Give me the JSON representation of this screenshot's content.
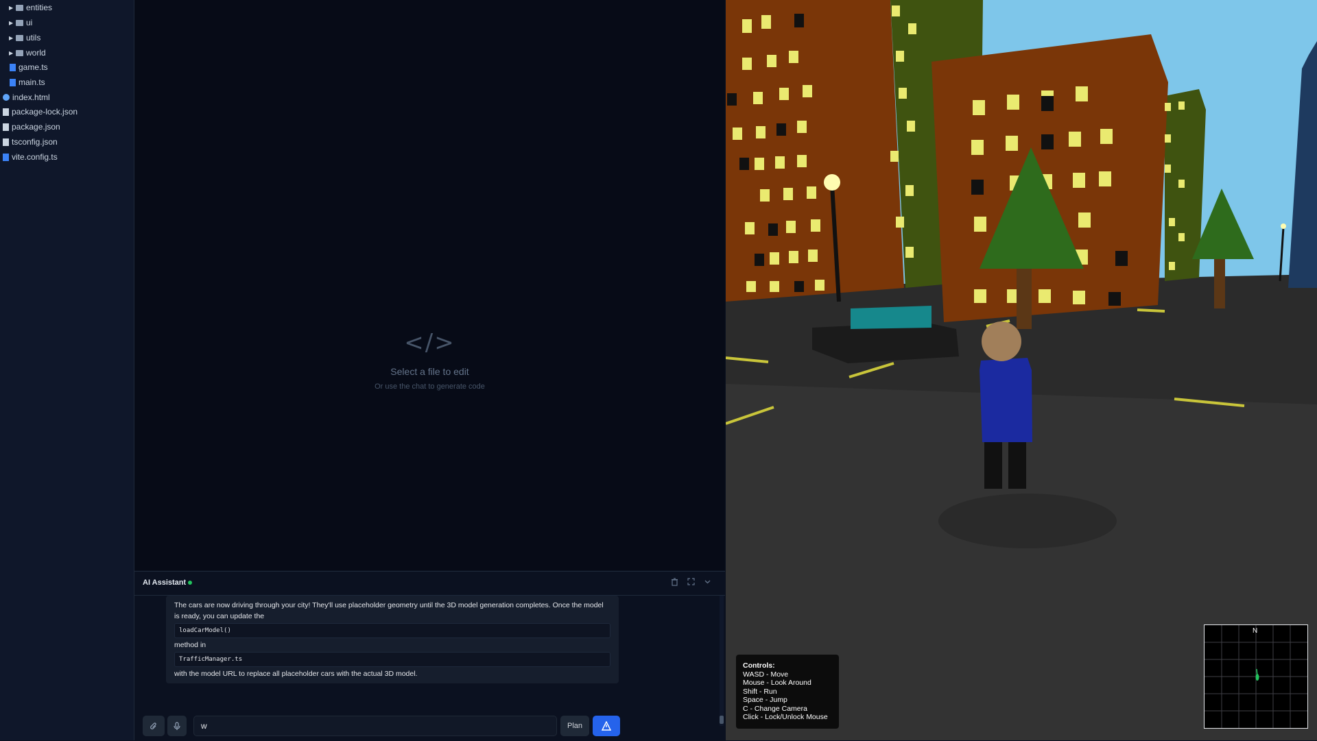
{
  "file_tree": [
    {
      "label": "entities",
      "type": "folder",
      "icon": "folder-icon"
    },
    {
      "label": "ui",
      "type": "folder",
      "icon": "folder-icon"
    },
    {
      "label": "utils",
      "type": "folder",
      "icon": "folder-icon"
    },
    {
      "label": "world",
      "type": "folder",
      "icon": "folder-icon"
    },
    {
      "label": "game.ts",
      "type": "file",
      "icon": "typescript-file-icon"
    },
    {
      "label": "main.ts",
      "type": "file",
      "icon": "typescript-file-icon"
    },
    {
      "label": "index.html",
      "type": "file",
      "icon": "html-file-icon"
    },
    {
      "label": "package-lock.json",
      "type": "file",
      "icon": "json-file-icon"
    },
    {
      "label": "package.json",
      "type": "file",
      "icon": "json-file-icon"
    },
    {
      "label": "tsconfig.json",
      "type": "file",
      "icon": "json-file-icon"
    },
    {
      "label": "vite.config.ts",
      "type": "file",
      "icon": "typescript-file-icon"
    }
  ],
  "editor": {
    "icon": "</>",
    "empty_title": "Select a file to edit",
    "empty_subtitle": "Or use the chat to generate code"
  },
  "assistant": {
    "title": "AI Assistant",
    "status_color": "#22c55e",
    "header_icons": [
      "trash-icon",
      "expand-icon",
      "chevron-down-icon"
    ],
    "message": {
      "text_1": "The cars are now driving through your city! They'll use placeholder geometry until the 3D model generation completes. Once the model is ready, you can update the",
      "code_1": "loadCarModel()",
      "text_2": "method in",
      "code_2": "TrafficManager.ts",
      "text_3": "with the model URL to replace all placeholder cars with the actual 3D model."
    },
    "input_value": "w",
    "plan_label": "Plan",
    "send_color": "#2563eb"
  },
  "game": {
    "sky_color": "#7ec6ea",
    "controls": {
      "title": "Controls:",
      "lines": [
        "WASD - Move",
        "Mouse - Look Around",
        "Shift - Run",
        "Space - Jump",
        "C - Change Camera",
        "Click - Lock/Unlock Mouse"
      ]
    },
    "minimap": {
      "north_label": "N"
    }
  }
}
